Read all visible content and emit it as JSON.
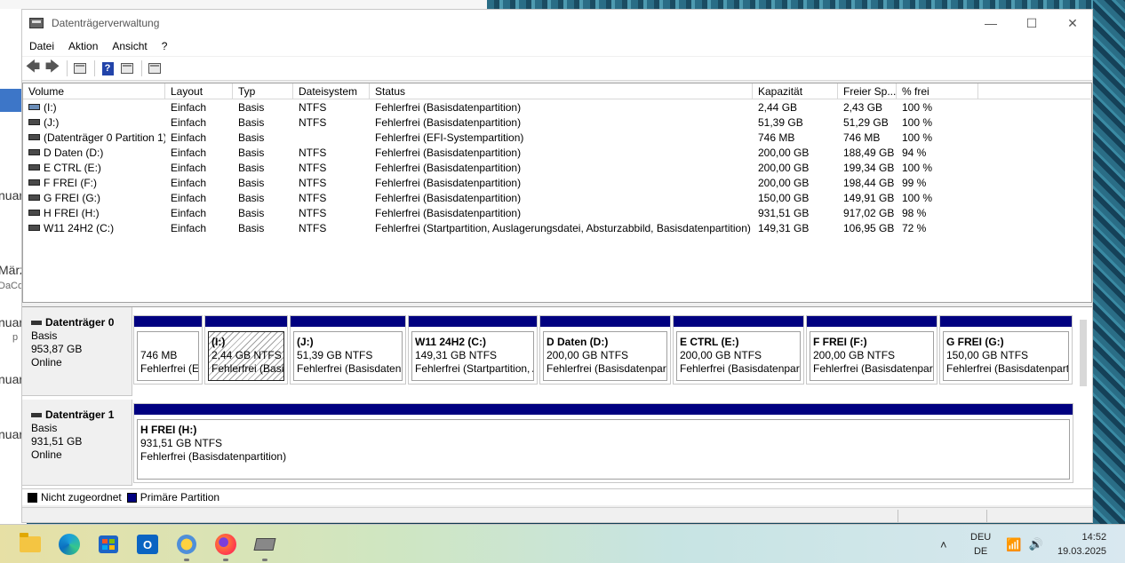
{
  "window": {
    "title": "Datenträgerverwaltung",
    "controls": {
      "minimize": "—",
      "maximize": "☐",
      "close": "✕"
    }
  },
  "menu": [
    "Datei",
    "Aktion",
    "Ansicht",
    "?"
  ],
  "table": {
    "columns": [
      "Volume",
      "Layout",
      "Typ",
      "Dateisystem",
      "Status",
      "Kapazität",
      "Freier Sp...",
      "% frei"
    ],
    "rows": [
      {
        "volume": "(I:)",
        "layout": "Einfach",
        "type": "Basis",
        "fs": "NTFS",
        "status": "Fehlerfrei (Basisdatenpartition)",
        "capacity": "2,44 GB",
        "free": "2,43 GB",
        "pct": "100 %",
        "icon": "usb"
      },
      {
        "volume": "(J:)",
        "layout": "Einfach",
        "type": "Basis",
        "fs": "NTFS",
        "status": "Fehlerfrei (Basisdatenpartition)",
        "capacity": "51,39 GB",
        "free": "51,29 GB",
        "pct": "100 %",
        "icon": "disk"
      },
      {
        "volume": "(Datenträger 0 Partition 1)",
        "layout": "Einfach",
        "type": "Basis",
        "fs": "",
        "status": "Fehlerfrei (EFI-Systempartition)",
        "capacity": "746 MB",
        "free": "746 MB",
        "pct": "100 %",
        "icon": "disk"
      },
      {
        "volume": "D Daten (D:)",
        "layout": "Einfach",
        "type": "Basis",
        "fs": "NTFS",
        "status": "Fehlerfrei (Basisdatenpartition)",
        "capacity": "200,00 GB",
        "free": "188,49 GB",
        "pct": "94 %",
        "icon": "disk"
      },
      {
        "volume": "E CTRL (E:)",
        "layout": "Einfach",
        "type": "Basis",
        "fs": "NTFS",
        "status": "Fehlerfrei (Basisdatenpartition)",
        "capacity": "200,00 GB",
        "free": "199,34 GB",
        "pct": "100 %",
        "icon": "disk"
      },
      {
        "volume": "F FREI (F:)",
        "layout": "Einfach",
        "type": "Basis",
        "fs": "NTFS",
        "status": "Fehlerfrei (Basisdatenpartition)",
        "capacity": "200,00 GB",
        "free": "198,44 GB",
        "pct": "99 %",
        "icon": "disk"
      },
      {
        "volume": "G FREI (G:)",
        "layout": "Einfach",
        "type": "Basis",
        "fs": "NTFS",
        "status": "Fehlerfrei (Basisdatenpartition)",
        "capacity": "150,00 GB",
        "free": "149,91 GB",
        "pct": "100 %",
        "icon": "disk"
      },
      {
        "volume": "H FREI (H:)",
        "layout": "Einfach",
        "type": "Basis",
        "fs": "NTFS",
        "status": "Fehlerfrei (Basisdatenpartition)",
        "capacity": "931,51 GB",
        "free": "917,02 GB",
        "pct": "98 %",
        "icon": "disk"
      },
      {
        "volume": "W11 24H2 (C:)",
        "layout": "Einfach",
        "type": "Basis",
        "fs": "NTFS",
        "status": "Fehlerfrei (Startpartition, Auslagerungsdatei, Absturzabbild, Basisdatenpartition)",
        "capacity": "149,31 GB",
        "free": "106,95 GB",
        "pct": "72 %",
        "icon": "disk"
      }
    ]
  },
  "disks": [
    {
      "name": "Datenträger 0",
      "type": "Basis",
      "size": "953,87 GB",
      "state": "Online",
      "partitions": [
        {
          "name": "",
          "size": "746 MB",
          "status": "Fehlerfrei (EFI-Systempartition)"
        },
        {
          "name": "(I:)",
          "size": "2,44 GB NTFS",
          "status": "Fehlerfrei (Basisdatenpartition)",
          "selected": true
        },
        {
          "name": "(J:)",
          "size": "51,39 GB NTFS",
          "status": "Fehlerfrei (Basisdatenpartition)"
        },
        {
          "name": "W11 24H2  (C:)",
          "size": "149,31 GB NTFS",
          "status": "Fehlerfrei (Startpartition, Auslagerungsdatei, Absturzabbild, Basisdatenpartition)"
        },
        {
          "name": "D Daten  (D:)",
          "size": "200,00 GB NTFS",
          "status": "Fehlerfrei (Basisdatenpartition)"
        },
        {
          "name": "E CTRL  (E:)",
          "size": "200,00 GB NTFS",
          "status": "Fehlerfrei (Basisdatenpartition)"
        },
        {
          "name": "F FREI  (F:)",
          "size": "200,00 GB NTFS",
          "status": "Fehlerfrei (Basisdatenpartition)"
        },
        {
          "name": "G FREI  (G:)",
          "size": "150,00 GB NTFS",
          "status": "Fehlerfrei (Basisdatenpartition)"
        }
      ]
    },
    {
      "name": "Datenträger 1",
      "type": "Basis",
      "size": "931,51 GB",
      "state": "Online",
      "partitions": [
        {
          "name": "H FREI  (H:)",
          "size": "931,51 GB NTFS",
          "status": "Fehlerfrei (Basisdatenpartition)"
        }
      ]
    }
  ],
  "legend": [
    {
      "label": "Nicht zugeordnet",
      "color": "#000000"
    },
    {
      "label": "Primäre Partition",
      "color": "#000080"
    }
  ],
  "desktop_fragments": [
    "März",
    "DaCo",
    "nuar",
    "nuar",
    "nuar",
    "nuar",
    "p"
  ],
  "taskbar": {
    "apps": [
      "folder-icon",
      "edge-icon",
      "store-icon",
      "outlook-icon",
      "weather-icon",
      "firefox-icon",
      "disk-management-icon"
    ],
    "language": "DEU",
    "layout": "DE",
    "time": "14:52",
    "date": "19.03.2025"
  }
}
